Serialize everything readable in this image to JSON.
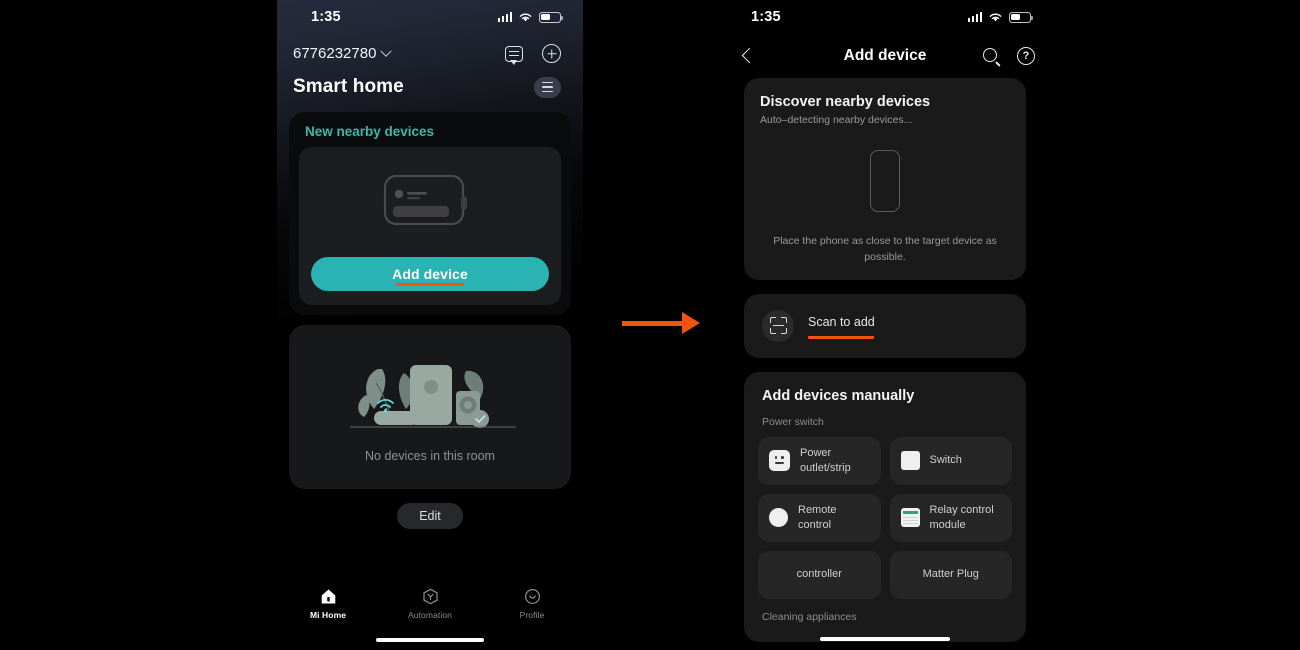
{
  "left_phone": {
    "status_bar": {
      "time": "1:35",
      "signal_icon": "signal-bars-icon",
      "wifi_icon": "wifi-icon",
      "battery_icon": "battery-icon"
    },
    "header": {
      "home_id": "6776232780",
      "dropdown_icon": "chevron-down-icon",
      "chat_icon": "chat-icon",
      "add_icon": "plus-circle-icon",
      "title": "Smart home",
      "menu_icon": "hamburger-menu-icon"
    },
    "nearby_card": {
      "title": "New nearby devices",
      "device_illustration": "smart-device-outline-illustration",
      "add_button_label": "Add device",
      "add_button_color": "#2ab3b3",
      "highlight_color": "#f4530d"
    },
    "room_card": {
      "illustration": "empty-room-devices-illustration",
      "empty_text": "No devices in this room"
    },
    "edit_button_label": "Edit",
    "tabs": [
      {
        "label": "Mi Home",
        "icon": "home-icon",
        "active": true
      },
      {
        "label": "Automation",
        "icon": "automation-hexagon-icon",
        "active": false
      },
      {
        "label": "Profile",
        "icon": "profile-smiley-icon",
        "active": false
      }
    ]
  },
  "arrow": {
    "name": "flow-arrow",
    "color": "#f4530d"
  },
  "right_phone": {
    "status_bar": {
      "time": "1:35",
      "signal_icon": "signal-bars-icon",
      "wifi_icon": "wifi-icon",
      "battery_icon": "battery-icon"
    },
    "navbar": {
      "back_icon": "back-chevron-icon",
      "title": "Add device",
      "search_icon": "search-icon",
      "help_icon": "help-circle-icon",
      "help_glyph": "?"
    },
    "discover": {
      "title": "Discover nearby devices",
      "subtitle": "Auto–detecting nearby devices...",
      "phone_graphic": "phone-outline-icon",
      "hint": "Place the phone as close to the target device as possible."
    },
    "scan": {
      "icon": "scan-qr-icon",
      "label": "Scan to add",
      "highlight_color": "#f4530d"
    },
    "manual": {
      "title": "Add devices manually",
      "categories": [
        {
          "label": "Power switch",
          "tiles": [
            {
              "label": "Power outlet/strip",
              "icon": "power-outlet-icon"
            },
            {
              "label": "Switch",
              "icon": "switch-icon"
            },
            {
              "label": "Remote control",
              "icon": "remote-control-icon"
            },
            {
              "label": "Relay control module",
              "icon": "relay-module-icon"
            },
            {
              "label": "controller",
              "icon": ""
            },
            {
              "label": "Matter Plug",
              "icon": ""
            }
          ]
        },
        {
          "label": "Cleaning appliances",
          "tiles": []
        }
      ]
    }
  }
}
